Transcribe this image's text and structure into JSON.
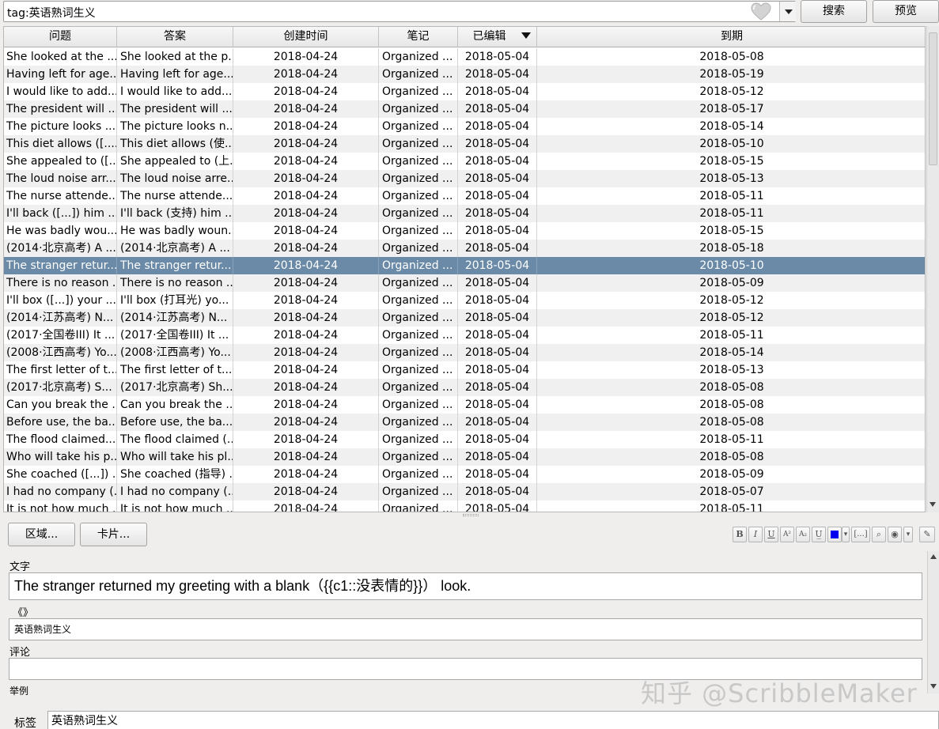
{
  "search": {
    "value": "tag:英语熟词生义"
  },
  "buttons": {
    "search": "搜索",
    "preview": "预览",
    "fields": "区域...",
    "cards": "卡片..."
  },
  "icons": [
    "heart-icon",
    "chevron-down-icon",
    "sort-descending-icon",
    "bold-icon",
    "italic-icon",
    "underline-icon",
    "superscript-icon",
    "subscript-icon",
    "clear-format-icon",
    "text-color-icon",
    "cloze-icon",
    "attachment-icon",
    "record-icon",
    "more-icon",
    "brush-icon"
  ],
  "toolbar": [
    "B",
    "I",
    "U",
    "A²",
    "A₂",
    "U̲",
    "",
    "▾",
    "[...]",
    "⌕",
    "◉",
    "▾",
    "✎"
  ],
  "colors": {
    "selected_row": "#6a8aa7",
    "text_color_swatch": "#0000ee"
  },
  "table": {
    "columns": [
      "问题",
      "答案",
      "创建时间",
      "笔记",
      "已编辑",
      "到期"
    ],
    "selected_index": 12,
    "rows": [
      [
        "She looked at the ...",
        "She looked at the p...",
        "2018-04-24",
        "Organized ...",
        "2018-05-04",
        "2018-05-08"
      ],
      [
        "Having left for age...",
        "Having left for age...",
        "2018-04-24",
        "Organized ...",
        "2018-05-04",
        "2018-05-19"
      ],
      [
        "I would like to add...",
        "I would like to add...",
        "2018-04-24",
        "Organized ...",
        "2018-05-04",
        "2018-05-12"
      ],
      [
        "The president will ...",
        "The president will ...",
        "2018-04-24",
        "Organized ...",
        "2018-05-04",
        "2018-05-17"
      ],
      [
        "The picture looks ...",
        "The picture looks n...",
        "2018-04-24",
        "Organized ...",
        "2018-05-04",
        "2018-05-14"
      ],
      [
        "This diet allows ([....",
        "This diet allows (使...",
        "2018-04-24",
        "Organized ...",
        "2018-05-04",
        "2018-05-10"
      ],
      [
        "She appealed to ([....",
        "She appealed to (上...",
        "2018-04-24",
        "Organized ...",
        "2018-05-04",
        "2018-05-15"
      ],
      [
        "The loud noise arr...",
        "The loud noise arre...",
        "2018-04-24",
        "Organized ...",
        "2018-05-04",
        "2018-05-13"
      ],
      [
        "The nurse attende...",
        "The nurse attende...",
        "2018-04-24",
        "Organized ...",
        "2018-05-04",
        "2018-05-11"
      ],
      [
        "I'll back ([...]) him ...",
        "I'll back (支持) him ...",
        "2018-04-24",
        "Organized ...",
        "2018-05-04",
        "2018-05-11"
      ],
      [
        "He was badly wou...",
        "He was badly woun...",
        "2018-04-24",
        "Organized ...",
        "2018-05-04",
        "2018-05-15"
      ],
      [
        "(2014·北京高考) A ...",
        "(2014·北京高考) A ...",
        "2018-04-24",
        "Organized ...",
        "2018-05-04",
        "2018-05-18"
      ],
      [
        "The stranger retur...",
        "The stranger retur...",
        "2018-04-24",
        "Organized ...",
        "2018-05-04",
        "2018-05-10"
      ],
      [
        "There is no reason ...",
        "There is no reason ...",
        "2018-04-24",
        "Organized ...",
        "2018-05-04",
        "2018-05-09"
      ],
      [
        "I'll box ([...]) your ...",
        "I'll box (打耳光) yo...",
        "2018-04-24",
        "Organized ...",
        "2018-05-04",
        "2018-05-12"
      ],
      [
        "(2014·江苏高考) N...",
        "(2014·江苏高考) N...",
        "2018-04-24",
        "Organized ...",
        "2018-05-04",
        "2018-05-12"
      ],
      [
        "(2017·全国卷III) It ...",
        "(2017·全国卷III) It ...",
        "2018-04-24",
        "Organized ...",
        "2018-05-04",
        "2018-05-11"
      ],
      [
        "(2008·江西高考) Yo...",
        "(2008·江西高考) Yo...",
        "2018-04-24",
        "Organized ...",
        "2018-05-04",
        "2018-05-14"
      ],
      [
        "The first letter of t...",
        "The first letter of t...",
        "2018-04-24",
        "Organized ...",
        "2018-05-04",
        "2018-05-13"
      ],
      [
        "(2017·北京高考) S...",
        "(2017·北京高考) Sh...",
        "2018-04-24",
        "Organized ...",
        "2018-05-04",
        "2018-05-08"
      ],
      [
        "Can you break the ...",
        "Can you break the ...",
        "2018-04-24",
        "Organized ...",
        "2018-05-04",
        "2018-05-08"
      ],
      [
        "Before use, the ba...",
        "Before use, the ba...",
        "2018-04-24",
        "Organized ...",
        "2018-05-04",
        "2018-05-08"
      ],
      [
        "The flood claimed...",
        "The flood claimed (...",
        "2018-04-24",
        "Organized ...",
        "2018-05-04",
        "2018-05-11"
      ],
      [
        "Who will take his p...",
        "Who will take his pl...",
        "2018-04-24",
        "Organized ...",
        "2018-05-04",
        "2018-05-08"
      ],
      [
        "She coached ([...]) ...",
        "She coached (指导) ...",
        "2018-04-24",
        "Organized ...",
        "2018-05-04",
        "2018-05-09"
      ],
      [
        "I had no company (...",
        "I had no company (...",
        "2018-04-24",
        "Organized ...",
        "2018-05-04",
        "2018-05-07"
      ],
      [
        "It is not how much ...",
        "It is not how much ...",
        "2018-04-24",
        "Organized ...",
        "2018-05-04",
        "2018-05-11"
      ]
    ]
  },
  "editor": {
    "text_label": "文字",
    "text_value": "The stranger returned my greeting with a blank（{{c1::没表情的}}） look.",
    "source_label": "《》",
    "source_value": "英语熟词生义",
    "comment_label": "评论",
    "comment_value": "",
    "example_label": "举例",
    "tags_label": "标签",
    "tags_value": "英语熟词生义"
  },
  "watermark": "知乎 @ScribbleMaker"
}
